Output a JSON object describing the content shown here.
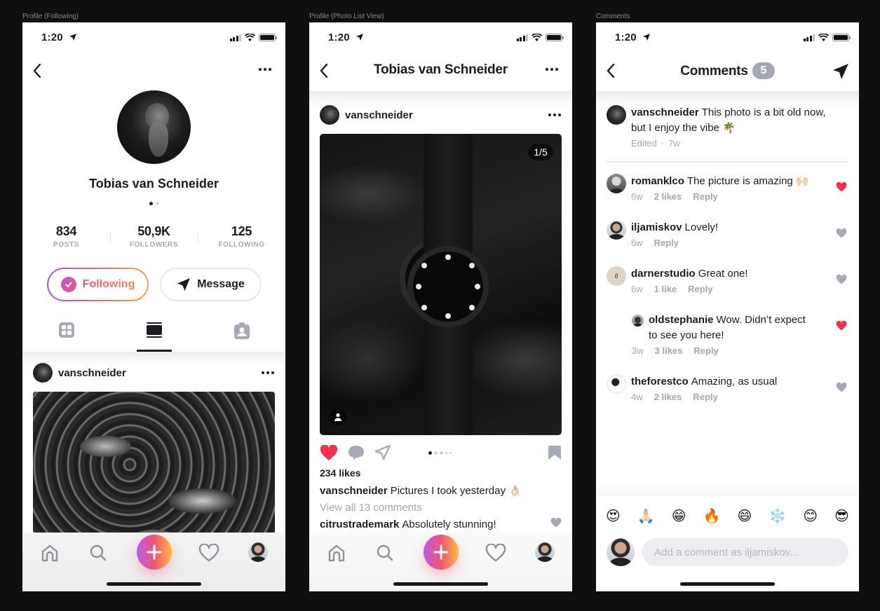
{
  "frames": [
    {
      "label": "Profile (Following)"
    },
    {
      "label": "Profile (Photo List View)"
    },
    {
      "label": "Comments"
    }
  ],
  "status_bar": {
    "time": "1:20",
    "location_icon": "location-arrow-icon",
    "signal_icon": "signal-bars-icon",
    "wifi_icon": "wifi-icon",
    "battery_icon": "battery-icon"
  },
  "profile": {
    "name": "Tobias van Schneider",
    "pager": {
      "pages": 2,
      "current": 1
    },
    "stats": [
      {
        "value": "834",
        "label": "POSTS"
      },
      {
        "value": "50,9K",
        "label": "FOLLOWERS"
      },
      {
        "value": "125",
        "label": "FOLLOWING"
      }
    ],
    "following_button": "Following",
    "message_button": "Message",
    "tabs": [
      {
        "icon": "grid-icon",
        "active": false
      },
      {
        "icon": "list-view-icon",
        "active": true
      },
      {
        "icon": "tagged-user-icon",
        "active": false
      }
    ],
    "post": {
      "username": "vanschneider"
    }
  },
  "photo_list": {
    "title": "Tobias van Schneider",
    "post": {
      "username": "vanschneider",
      "counter": "1/5",
      "carousel": {
        "pages": 5,
        "current": 1
      },
      "liked": true,
      "likes": "234 likes",
      "caption_user": "vanschneider",
      "caption_text": "Pictures I took yesterday 👌🏻",
      "view_all": "View all 13 comments",
      "top_comment_user": "citrustrademark",
      "top_comment_text": "Absolutely stunning!"
    }
  },
  "tab_bar": {
    "items": [
      "home-icon",
      "search-icon",
      "add-icon",
      "heart-icon",
      "profile-avatar"
    ]
  },
  "comments": {
    "title": "Comments",
    "count": "5",
    "original": {
      "user": "vanschneider",
      "text": "This photo is a bit old now, but I enjoy the vibe 🌴",
      "edited": "Edited",
      "time": "7w"
    },
    "items": [
      {
        "user": "romanklco",
        "text": "The picture is amazing 🙌🏻",
        "time": "6w",
        "likes": "2 likes",
        "reply": "Reply",
        "liked": true
      },
      {
        "user": "iljamiskov",
        "text": "Lovely!",
        "time": "6w",
        "likes": "",
        "reply": "Reply",
        "liked": false
      },
      {
        "user": "darnerstudio",
        "text": "Great one!",
        "time": "6w",
        "likes": "1 like",
        "reply": "Reply",
        "liked": false
      },
      {
        "user": "oldstephanie",
        "text": "Wow. Didn’t expect to see you here!",
        "time": "3w",
        "likes": "3 likes",
        "reply": "Reply",
        "liked": true,
        "nested": true
      },
      {
        "user": "theforestco",
        "text": "Amazing, as usual",
        "time": "4w",
        "likes": "2 likes",
        "reply": "Reply",
        "liked": false
      }
    ],
    "emojis": [
      "😍",
      "🙏🏻",
      "😁",
      "🔥",
      "😄",
      "❄️",
      "😊",
      "😎"
    ],
    "composer_placeholder": "Add a comment as iljamiskov..."
  },
  "colors": {
    "accent_gradient_start": "#b95ee0",
    "accent_gradient_mid": "#ee5576",
    "accent_gradient_end": "#ffb93a",
    "like_red": "#f5304f",
    "muted": "#a4a7b0",
    "text": "#1b1c22"
  }
}
